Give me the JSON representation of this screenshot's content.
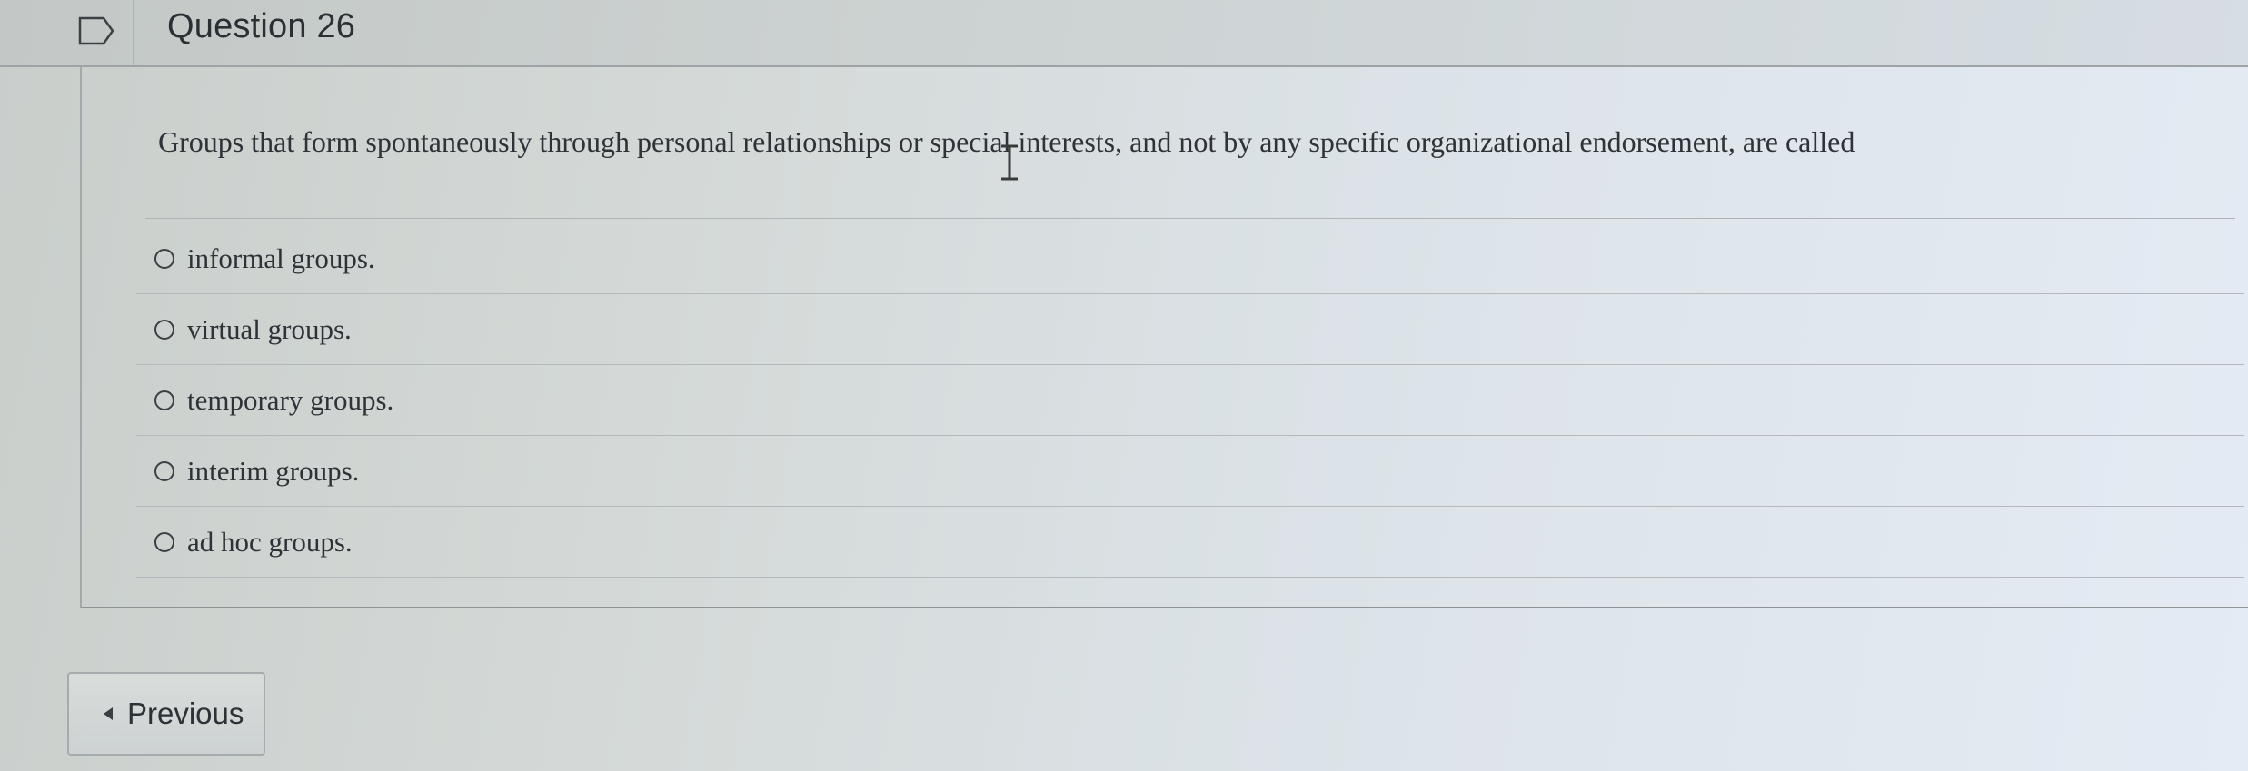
{
  "question": {
    "title": "Question 26",
    "text": "Groups that form spontaneously through personal relationships or special interests, and not by any specific organizational endorsement, are called"
  },
  "answers": [
    {
      "label": "informal groups."
    },
    {
      "label": "virtual groups."
    },
    {
      "label": "temporary groups."
    },
    {
      "label": "interim groups."
    },
    {
      "label": "ad hoc groups."
    }
  ],
  "navigation": {
    "previous_label": "Previous"
  },
  "icons": {
    "flag": "flag-outline-icon",
    "cursor": "i-beam-cursor-icon",
    "previous": "triangle-left-icon"
  }
}
